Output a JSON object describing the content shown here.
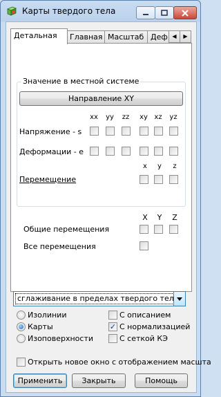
{
  "window": {
    "title": "Карты твердого тела",
    "minimize_icon": "minimize-icon",
    "maximize_icon": "maximize-icon",
    "close_icon": "close-icon"
  },
  "tabs": [
    {
      "label": "Детальная",
      "active": true
    },
    {
      "label": "Главная",
      "active": false
    },
    {
      "label": "Масштаб",
      "active": false
    },
    {
      "label": "Деф",
      "active": false
    }
  ],
  "tab_scroll": {
    "left": "◀",
    "right": "▶"
  },
  "local_system": {
    "group_label": "Значение в местной системе",
    "direction_button": "Направление XY",
    "columns": [
      "xx",
      "yy",
      "zz",
      "xy",
      "xz",
      "yz"
    ],
    "stress_label": "Напряжение - s",
    "strain_label": "Деформации - e",
    "displacement_columns": [
      "x",
      "y",
      "z"
    ],
    "displacement_label": "Перемещение"
  },
  "global": {
    "columns": [
      "X",
      "Y",
      "Z"
    ],
    "total_displacements_label": "Общие перемещения",
    "all_displacements_label": "Все перемещения"
  },
  "smoothing_combo": {
    "value": "сглаживание в пределах твердого тела"
  },
  "display_mode": {
    "options": [
      {
        "label": "Изолинии",
        "selected": false
      },
      {
        "label": "Карты",
        "selected": true
      },
      {
        "label": "Изоповерхности",
        "selected": false
      }
    ]
  },
  "options": [
    {
      "label": "С описанием",
      "checked": false
    },
    {
      "label": "С нормализацией",
      "checked": true
    },
    {
      "label": "С сеткой КЭ",
      "checked": false
    }
  ],
  "new_window": {
    "label": "Открыть новое окно с отображением масшта",
    "checked": false
  },
  "buttons": {
    "apply": "Применить",
    "close": "Закрыть",
    "help": "Помощь"
  },
  "check_mark": "✓"
}
